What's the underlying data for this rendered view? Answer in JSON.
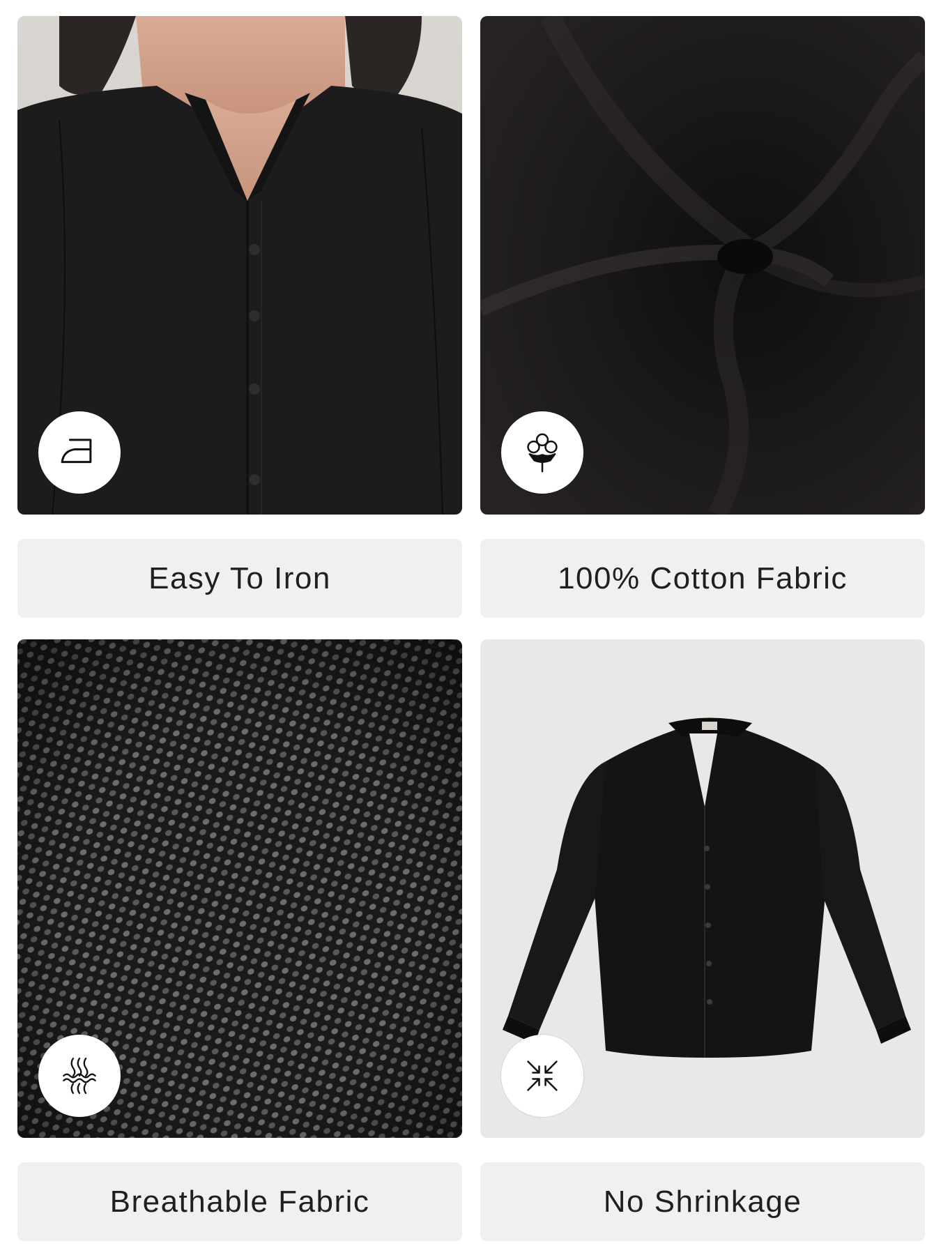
{
  "features": [
    {
      "label": "Easy To Iron",
      "icon": "iron-icon",
      "image": "model-wearing-black-shirt"
    },
    {
      "label": "100% Cotton Fabric",
      "icon": "cotton-flower-icon",
      "image": "black-fabric-swirl"
    },
    {
      "label": "Breathable Fabric",
      "icon": "breathable-fabric-icon",
      "image": "fabric-weave-closeup"
    },
    {
      "label": "No Shrinkage",
      "icon": "no-shrink-arrows-icon",
      "image": "black-shirt-flatlay"
    }
  ],
  "colors": {
    "label_background": "#f2f0ee",
    "label_text": "#1f1f1f",
    "badge_background": "#ffffff",
    "fabric": "#1a1a1a"
  }
}
